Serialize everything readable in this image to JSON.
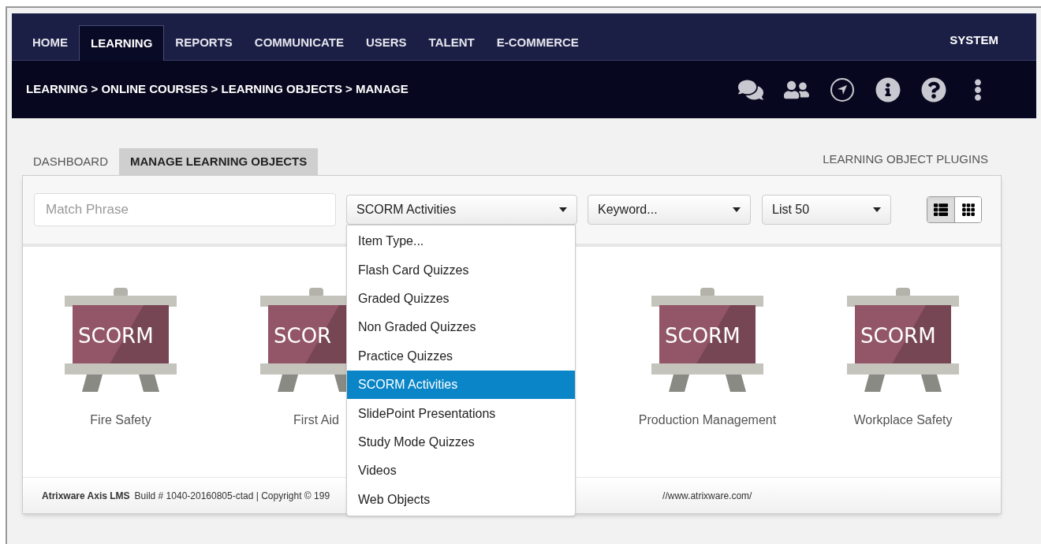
{
  "top_nav": {
    "items": [
      {
        "label": "HOME",
        "selected": false
      },
      {
        "label": "LEARNING",
        "selected": true
      },
      {
        "label": "REPORTS",
        "selected": false
      },
      {
        "label": "COMMUNICATE",
        "selected": false
      },
      {
        "label": "USERS",
        "selected": false
      },
      {
        "label": "TALENT",
        "selected": false
      },
      {
        "label": "E-COMMERCE",
        "selected": false
      }
    ],
    "right_item": "SYSTEM"
  },
  "breadcrumb": "LEARNING > ONLINE COURSES > LEARNING OBJECTS > MANAGE",
  "tabs": [
    {
      "label": "DASHBOARD",
      "selected": false
    },
    {
      "label": "MANAGE LEARNING OBJECTS",
      "selected": true
    }
  ],
  "plugins_link": "LEARNING OBJECT PLUGINS",
  "filters": {
    "search": {
      "placeholder": "Match Phrase"
    },
    "type_select": "SCORM Activities",
    "keyword_select": "Keyword...",
    "list_select": "List 50",
    "views": [
      {
        "kind": "list",
        "selected": true
      },
      {
        "kind": "grid",
        "selected": false
      }
    ]
  },
  "dropdown": {
    "options": [
      {
        "label": "Item Type...",
        "selected": false
      },
      {
        "label": "Flash Card Quizzes",
        "selected": false
      },
      {
        "label": "Graded Quizzes",
        "selected": false
      },
      {
        "label": "Non Graded Quizzes",
        "selected": false
      },
      {
        "label": "Practice Quizzes",
        "selected": false
      },
      {
        "label": "SCORM Activities",
        "selected": true
      },
      {
        "label": "SlidePoint Presentations",
        "selected": false
      },
      {
        "label": "Study Mode Quizzes",
        "selected": false
      },
      {
        "label": "Videos",
        "selected": false
      },
      {
        "label": "Web Objects",
        "selected": false
      }
    ]
  },
  "cards": [
    {
      "badge": "SCORM",
      "title": "Fire Safety"
    },
    {
      "badge": "SCOR",
      "title": "First Aid"
    },
    {
      "badge": "SCORM",
      "title": "Production Management"
    },
    {
      "badge": "SCORM",
      "title": "Workplace Safety"
    }
  ],
  "footer": {
    "brand": "Atrixware Axis LMS",
    "text_left": "Build # 1040-20160805-ctad | Copyright © 199",
    "text_right": "//www.atrixware.com/"
  }
}
